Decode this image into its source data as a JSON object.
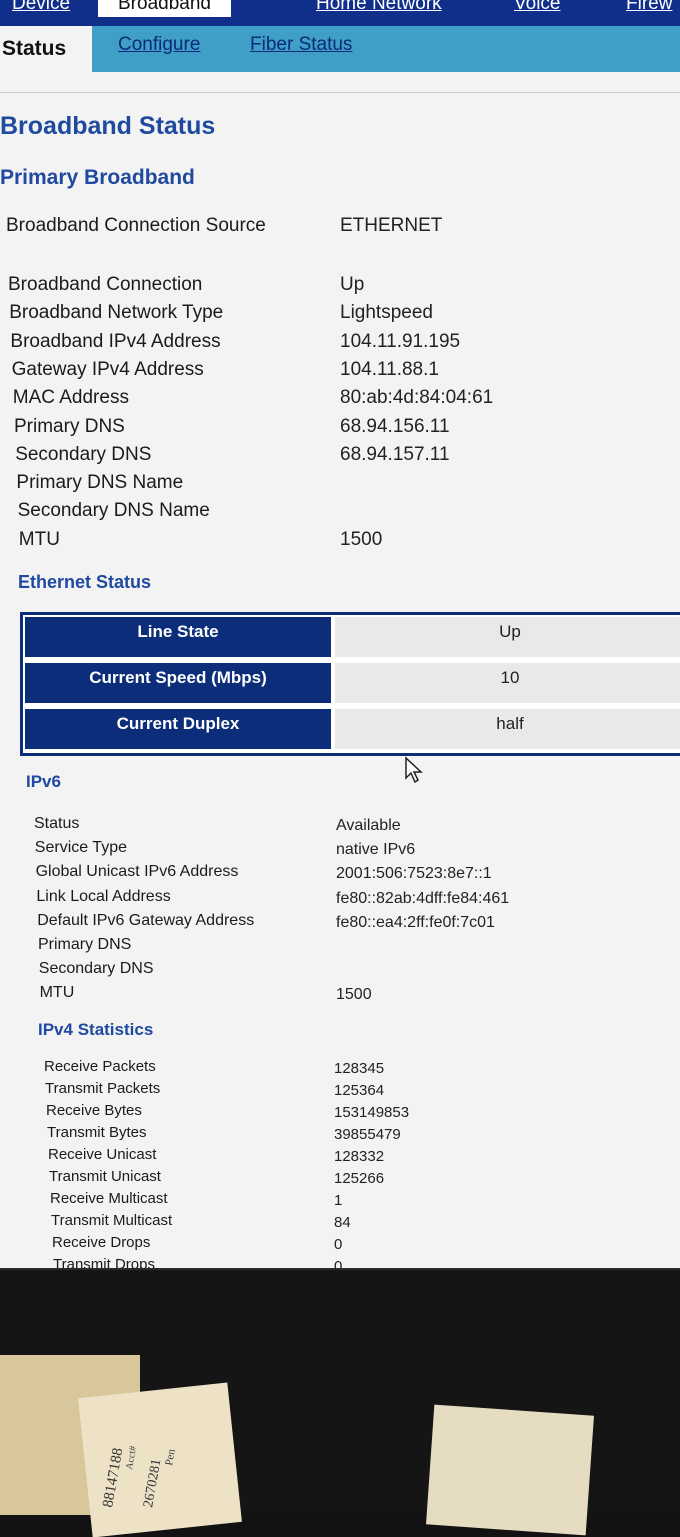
{
  "nav": {
    "tabs": [
      "Device",
      "Broadband",
      "Home Network",
      "Voice",
      "Firew"
    ],
    "active_tab": "Broadband"
  },
  "subnav": {
    "tabs": [
      "Status",
      "Configure",
      "Fiber Status"
    ],
    "active_tab": "Status"
  },
  "page": {
    "title": "Broadband Status"
  },
  "primary": {
    "title": "Primary Broadband",
    "source_label": "Broadband Connection Source",
    "source_value": "ETHERNET",
    "rows": [
      {
        "label": "Broadband Connection",
        "value": "Up"
      },
      {
        "label": "Broadband Network Type",
        "value": "Lightspeed"
      },
      {
        "label": "Broadband IPv4 Address",
        "value": "104.11.91.195"
      },
      {
        "label": "Gateway IPv4 Address",
        "value": "104.11.88.1"
      },
      {
        "label": "MAC Address",
        "value": "80:ab:4d:84:04:61"
      },
      {
        "label": "Primary DNS",
        "value": "68.94.156.11"
      },
      {
        "label": "Secondary DNS",
        "value": "68.94.157.11"
      },
      {
        "label": "Primary DNS Name",
        "value": ""
      },
      {
        "label": "Secondary DNS Name",
        "value": ""
      },
      {
        "label": "MTU",
        "value": "1500"
      }
    ]
  },
  "ethernet": {
    "title": "Ethernet Status",
    "rows": [
      {
        "label": "Line State",
        "value": "Up"
      },
      {
        "label": "Current Speed (Mbps)",
        "value": "10"
      },
      {
        "label": "Current Duplex",
        "value": "half"
      }
    ]
  },
  "ipv6": {
    "title": "IPv6",
    "rows": [
      {
        "label": "Status",
        "value": "Available"
      },
      {
        "label": "Service Type",
        "value": "native IPv6"
      },
      {
        "label": "Global Unicast IPv6 Address",
        "value": "2001:506:7523:8e7::1"
      },
      {
        "label": "Link Local Address",
        "value": "fe80::82ab:4dff:fe84:461"
      },
      {
        "label": "Default IPv6 Gateway Address",
        "value": "fe80::ea4:2ff:fe0f:7c01"
      },
      {
        "label": "Primary DNS",
        "value": ""
      },
      {
        "label": "Secondary DNS",
        "value": ""
      },
      {
        "label": "MTU",
        "value": "1500"
      }
    ]
  },
  "ipv4_stats": {
    "title": "IPv4 Statistics",
    "rows": [
      {
        "label": "Receive Packets",
        "value": "128345"
      },
      {
        "label": "Transmit Packets",
        "value": "125364"
      },
      {
        "label": "Receive Bytes",
        "value": "153149853"
      },
      {
        "label": "Transmit Bytes",
        "value": "39855479"
      },
      {
        "label": "Receive Unicast",
        "value": "128332"
      },
      {
        "label": "Transmit Unicast",
        "value": "125266"
      },
      {
        "label": "Receive Multicast",
        "value": "1"
      },
      {
        "label": "Transmit Multicast",
        "value": "84"
      },
      {
        "label": "Receive Drops",
        "value": "0"
      },
      {
        "label": "Transmit Drops",
        "value": "0"
      }
    ]
  },
  "desk": {
    "handwriting": [
      "88147188",
      "Acct#",
      "2670281",
      "Pen"
    ]
  },
  "colors": {
    "nav_bg": "#0f2f8a",
    "subnav_bg": "#3f9fc6",
    "heading_blue": "#1f4aa0",
    "table_header": "#0b2d7a"
  }
}
